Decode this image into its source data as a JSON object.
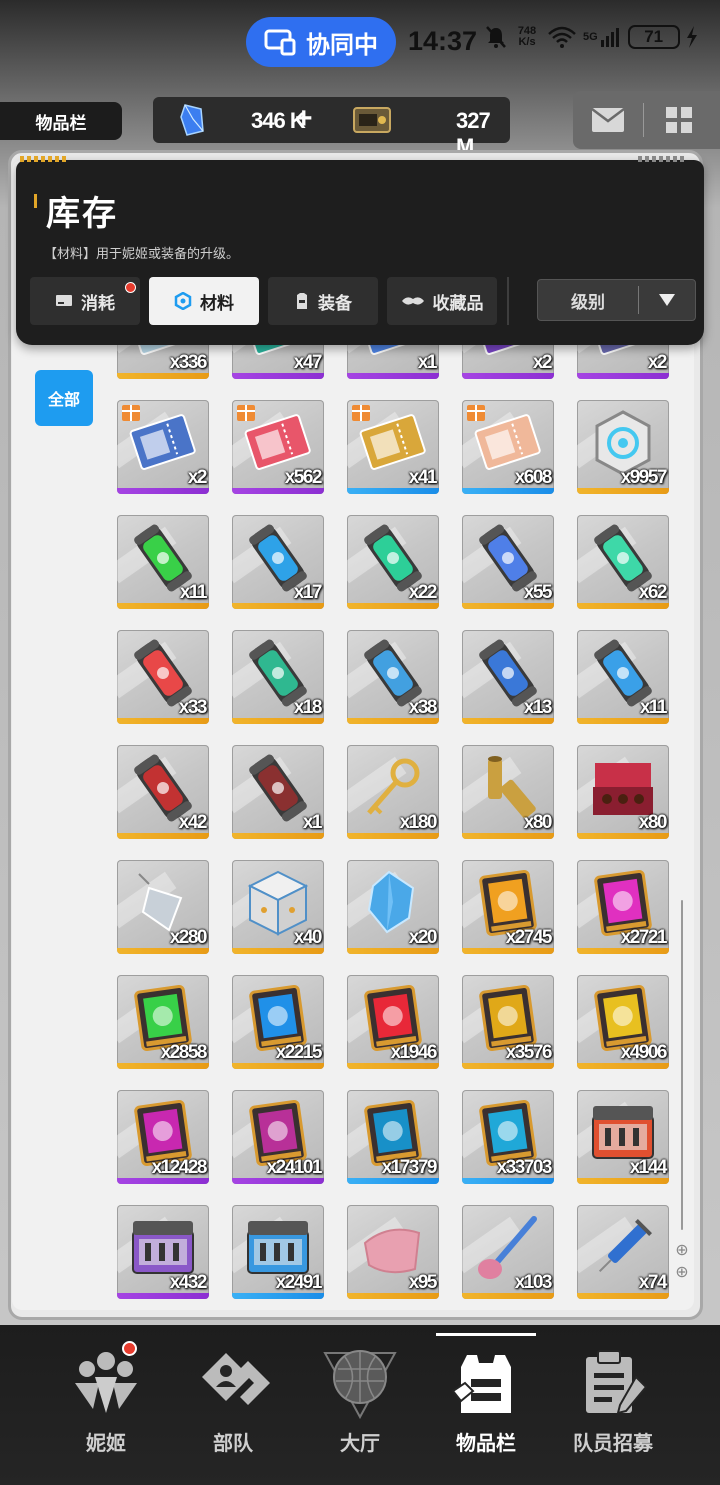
{
  "status_bar": {
    "collab_label": "协同中",
    "time": "14:37",
    "net_speed_value": "748",
    "net_speed_unit": "K/s",
    "signal_label": "5G",
    "battery": "71"
  },
  "top_bar": {
    "page_tag": "物品栏",
    "gems": "346 K",
    "plus": "+",
    "tickets": "327 M"
  },
  "inventory": {
    "title": "库存",
    "description": "【材料】用于妮姬或装备的升级。",
    "tabs": [
      {
        "label": "消耗",
        "has_notification": true
      },
      {
        "label": "材料",
        "active": true
      },
      {
        "label": "装备"
      },
      {
        "label": "收藏品"
      }
    ],
    "sort_label": "级别",
    "category_all": "全部"
  },
  "items": [
    {
      "qty": "x336",
      "rarity": "gold",
      "icon": "ticket-icon",
      "color": "#b8d8e8"
    },
    {
      "qty": "x47",
      "rarity": "purple",
      "icon": "ticket-icon",
      "color": "#2ab7a0"
    },
    {
      "qty": "x1",
      "rarity": "purple",
      "icon": "ticket-icon",
      "color": "#4f86e8"
    },
    {
      "qty": "x2",
      "rarity": "purple",
      "icon": "ticket-icon",
      "color": "#7a46c8"
    },
    {
      "qty": "x2",
      "rarity": "purple",
      "icon": "ticket-icon",
      "color": "#6a6ab0"
    },
    {
      "qty": "x2",
      "rarity": "purple",
      "icon": "dinner-voucher-icon",
      "color": "#4a74c8",
      "gift": true
    },
    {
      "qty": "x562",
      "rarity": "purple",
      "icon": "pink-ticket-icon",
      "color": "#e8566a",
      "gift": true
    },
    {
      "qty": "x41",
      "rarity": "blue",
      "icon": "day-ticket-icon",
      "color": "#d9a73a",
      "gift": true
    },
    {
      "qty": "x608",
      "rarity": "blue",
      "icon": "cake-ticket-icon",
      "color": "#f0b89a",
      "gift": true
    },
    {
      "qty": "x9957",
      "rarity": "gold",
      "icon": "core-dust-icon",
      "color": "#44c8f0"
    },
    {
      "qty": "x11",
      "rarity": "gold",
      "icon": "battery-canister-icon",
      "color": "#39d048"
    },
    {
      "qty": "x17",
      "rarity": "gold",
      "icon": "battery-canister-icon",
      "color": "#2ea2e8"
    },
    {
      "qty": "x22",
      "rarity": "gold",
      "icon": "battery-canister-icon",
      "color": "#2dcf98"
    },
    {
      "qty": "x55",
      "rarity": "gold",
      "icon": "battery-canister-icon",
      "color": "#4f7fe8"
    },
    {
      "qty": "x62",
      "rarity": "gold",
      "icon": "battery-canister-icon",
      "color": "#3ed8a8"
    },
    {
      "qty": "x33",
      "rarity": "gold",
      "icon": "battery-canister-icon",
      "color": "#e84848"
    },
    {
      "qty": "x18",
      "rarity": "gold",
      "icon": "battery-canister-icon",
      "color": "#2fb890"
    },
    {
      "qty": "x38",
      "rarity": "gold",
      "icon": "battery-canister-icon",
      "color": "#42a0e0"
    },
    {
      "qty": "x13",
      "rarity": "gold",
      "icon": "battery-canister-icon",
      "color": "#3a78d8"
    },
    {
      "qty": "x11",
      "rarity": "gold",
      "icon": "battery-canister-icon",
      "color": "#3aa0e8"
    },
    {
      "qty": "x42",
      "rarity": "gold",
      "icon": "battery-canister-icon",
      "color": "#c23232"
    },
    {
      "qty": "x1",
      "rarity": "gold",
      "icon": "battery-canister-icon",
      "color": "#8a3030"
    },
    {
      "qty": "x180",
      "rarity": "gold",
      "icon": "golden-key-icon",
      "color": "#e0b040"
    },
    {
      "qty": "x80",
      "rarity": "gold",
      "icon": "bullet-casing-icon",
      "color": "#caa040"
    },
    {
      "qty": "x80",
      "rarity": "gold",
      "icon": "chocolate-box-icon",
      "color": "#c83048"
    },
    {
      "qty": "x280",
      "rarity": "gold",
      "icon": "crystal-pendant-icon",
      "color": "#c8d0d8"
    },
    {
      "qty": "x40",
      "rarity": "gold",
      "icon": "dice-cube-icon",
      "color": "#5090c8"
    },
    {
      "qty": "x20",
      "rarity": "gold",
      "icon": "blue-crystal-icon",
      "color": "#4aa8e8"
    },
    {
      "qty": "x2745",
      "rarity": "gold",
      "icon": "data-tablet-icon",
      "color": "#f0a020"
    },
    {
      "qty": "x2721",
      "rarity": "gold",
      "icon": "data-tablet-icon",
      "color": "#e030c0"
    },
    {
      "qty": "x2858",
      "rarity": "gold",
      "icon": "data-tablet-icon",
      "color": "#38d048"
    },
    {
      "qty": "x2215",
      "rarity": "gold",
      "icon": "data-tablet-icon",
      "color": "#2090e8"
    },
    {
      "qty": "x1946",
      "rarity": "gold",
      "icon": "data-tablet-icon",
      "color": "#e82838"
    },
    {
      "qty": "x3576",
      "rarity": "gold",
      "icon": "data-tablet-icon",
      "color": "#e0a818"
    },
    {
      "qty": "x4906",
      "rarity": "gold",
      "icon": "data-tablet-icon",
      "color": "#e8c020"
    },
    {
      "qty": "x12428",
      "rarity": "purple",
      "icon": "data-tablet-icon",
      "color": "#c828b0"
    },
    {
      "qty": "x24101",
      "rarity": "purple",
      "icon": "data-tablet-icon",
      "color": "#b83098"
    },
    {
      "qty": "x17379",
      "rarity": "blue",
      "icon": "data-tablet-icon",
      "color": "#1890c8"
    },
    {
      "qty": "x33703",
      "rarity": "blue",
      "icon": "data-tablet-icon",
      "color": "#20a8d8"
    },
    {
      "qty": "x144",
      "rarity": "gold",
      "icon": "toolbox-icon",
      "color": "#e05030"
    },
    {
      "qty": "x432",
      "rarity": "purple",
      "icon": "toolbox-icon",
      "color": "#8a58c8"
    },
    {
      "qty": "x2491",
      "rarity": "blue",
      "icon": "toolbox-icon",
      "color": "#3898e0"
    },
    {
      "qty": "x95",
      "rarity": "gold",
      "icon": "cloth-icon",
      "color": "#e8a0b0"
    },
    {
      "qty": "x103",
      "rarity": "gold",
      "icon": "brush-icon",
      "color": "#4880d8"
    },
    {
      "qty": "x74",
      "rarity": "gold",
      "icon": "syringe-icon",
      "color": "#3070d0"
    }
  ],
  "nav": [
    {
      "label": "妮姬",
      "icon": "nikke-icon",
      "notification": true
    },
    {
      "label": "部队",
      "icon": "squad-icon"
    },
    {
      "label": "大厅",
      "icon": "lobby-icon"
    },
    {
      "label": "物品栏",
      "icon": "inventory-icon",
      "active": true
    },
    {
      "label": "队员招募",
      "icon": "recruit-icon"
    }
  ]
}
